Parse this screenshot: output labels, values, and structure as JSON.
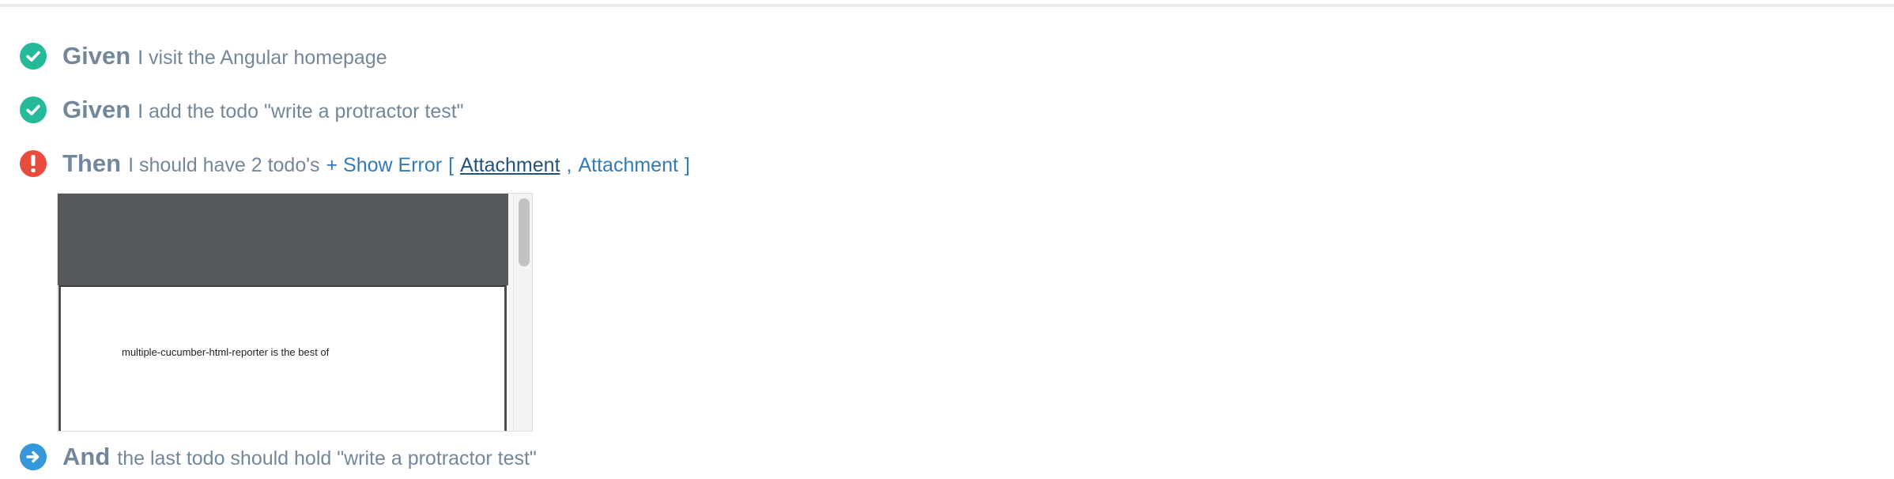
{
  "steps": [
    {
      "status": "passed",
      "icon": "check-circle-icon",
      "keyword": "Given",
      "text": "I visit the Angular homepage"
    },
    {
      "status": "passed",
      "icon": "check-circle-icon",
      "keyword": "Given",
      "text": "I add the todo \"write a protractor test\""
    },
    {
      "status": "failed",
      "icon": "exclamation-circle-icon",
      "keyword": "Then",
      "text": "I should have 2 todo's",
      "show_error_label": "+ Show Error",
      "attachments_open": "[",
      "attachments_close": "]",
      "attachment_separator": ",",
      "attachments": [
        "Attachment",
        "Attachment"
      ]
    },
    {
      "status": "pending",
      "icon": "arrow-circle-right-icon",
      "keyword": "And",
      "text": "the last todo should hold \"write a protractor test\""
    }
  ],
  "attachment_preview": {
    "text": "multiple-cucumber-html-reporter is the best of"
  },
  "colors": {
    "passed": "#26b99a",
    "failed": "#e74c3c",
    "pending": "#3498db",
    "keyword": "#73879c",
    "link": "#337ab7"
  }
}
